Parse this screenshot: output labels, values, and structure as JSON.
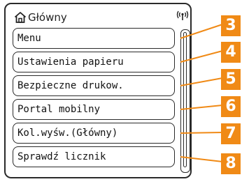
{
  "header": {
    "title": "Główny",
    "home_icon": "home-icon",
    "signal_icon": "wireless-signal-icon"
  },
  "menu": {
    "items": [
      {
        "label": "Menu",
        "callout": "3"
      },
      {
        "label": "Ustawienia papieru",
        "callout": "4"
      },
      {
        "label": "Bezpieczne drukow.",
        "callout": "5"
      },
      {
        "label": "Portal mobilny",
        "callout": "6"
      },
      {
        "label": "Kol.wyśw.(Główny)",
        "callout": "7"
      },
      {
        "label": "Sprawdź licznik",
        "callout": "8"
      }
    ]
  },
  "colors": {
    "callout_bg": "#f08a16",
    "callout_line": "#f08a16",
    "border": "#2a2a2a"
  }
}
